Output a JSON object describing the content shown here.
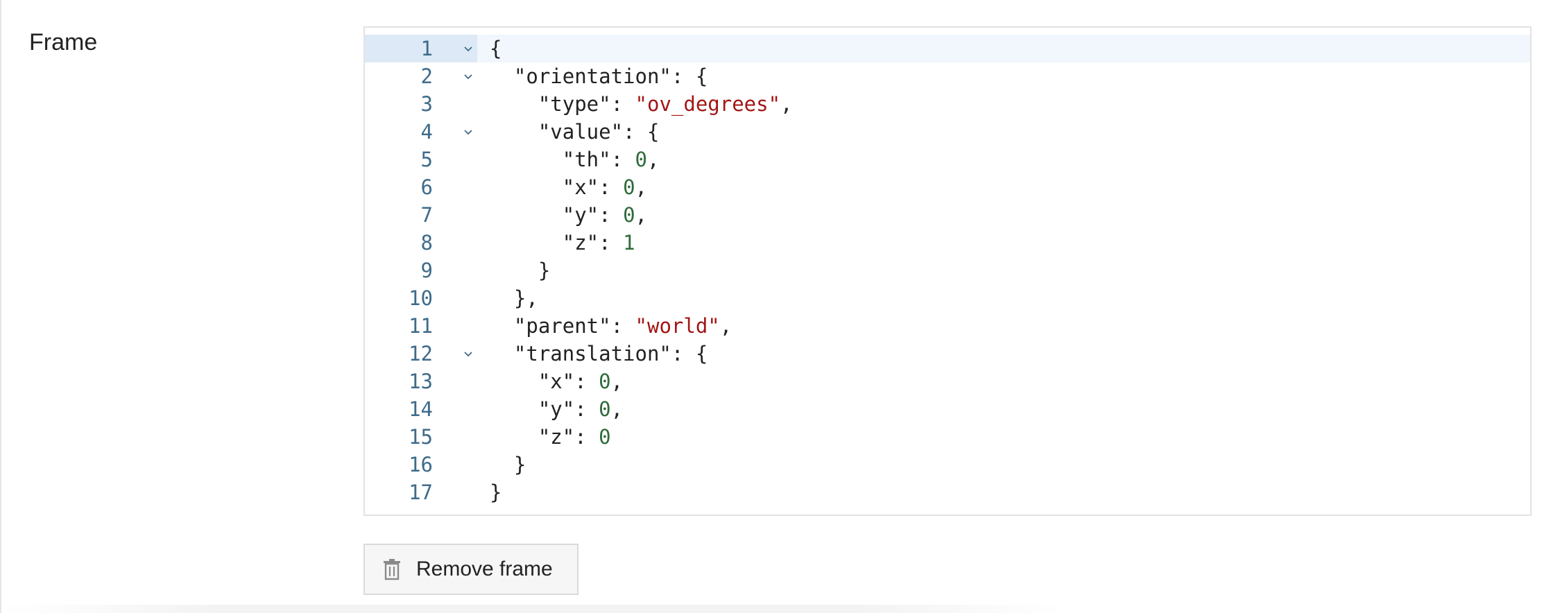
{
  "field": {
    "label": "Frame"
  },
  "editor": {
    "lines": [
      {
        "num": "1",
        "fold": true,
        "indent": "",
        "tokens": [
          {
            "t": "p",
            "v": "{"
          }
        ]
      },
      {
        "num": "2",
        "fold": true,
        "indent": "  ",
        "tokens": [
          {
            "t": "p",
            "v": "\"orientation\": {"
          }
        ]
      },
      {
        "num": "3",
        "fold": false,
        "indent": "    ",
        "tokens": [
          {
            "t": "p",
            "v": "\"type\": "
          },
          {
            "t": "s",
            "v": "\"ov_degrees\""
          },
          {
            "t": "p",
            "v": ","
          }
        ]
      },
      {
        "num": "4",
        "fold": true,
        "indent": "    ",
        "tokens": [
          {
            "t": "p",
            "v": "\"value\": {"
          }
        ]
      },
      {
        "num": "5",
        "fold": false,
        "indent": "      ",
        "tokens": [
          {
            "t": "p",
            "v": "\"th\": "
          },
          {
            "t": "n",
            "v": "0"
          },
          {
            "t": "p",
            "v": ","
          }
        ]
      },
      {
        "num": "6",
        "fold": false,
        "indent": "      ",
        "tokens": [
          {
            "t": "p",
            "v": "\"x\": "
          },
          {
            "t": "n",
            "v": "0"
          },
          {
            "t": "p",
            "v": ","
          }
        ]
      },
      {
        "num": "7",
        "fold": false,
        "indent": "      ",
        "tokens": [
          {
            "t": "p",
            "v": "\"y\": "
          },
          {
            "t": "n",
            "v": "0"
          },
          {
            "t": "p",
            "v": ","
          }
        ]
      },
      {
        "num": "8",
        "fold": false,
        "indent": "      ",
        "tokens": [
          {
            "t": "p",
            "v": "\"z\": "
          },
          {
            "t": "n",
            "v": "1"
          }
        ]
      },
      {
        "num": "9",
        "fold": false,
        "indent": "    ",
        "tokens": [
          {
            "t": "p",
            "v": "}"
          }
        ]
      },
      {
        "num": "10",
        "fold": false,
        "indent": "  ",
        "tokens": [
          {
            "t": "p",
            "v": "},"
          }
        ]
      },
      {
        "num": "11",
        "fold": false,
        "indent": "  ",
        "tokens": [
          {
            "t": "p",
            "v": "\"parent\": "
          },
          {
            "t": "s",
            "v": "\"world\""
          },
          {
            "t": "p",
            "v": ","
          }
        ]
      },
      {
        "num": "12",
        "fold": true,
        "indent": "  ",
        "tokens": [
          {
            "t": "p",
            "v": "\"translation\": {"
          }
        ]
      },
      {
        "num": "13",
        "fold": false,
        "indent": "    ",
        "tokens": [
          {
            "t": "p",
            "v": "\"x\": "
          },
          {
            "t": "n",
            "v": "0"
          },
          {
            "t": "p",
            "v": ","
          }
        ]
      },
      {
        "num": "14",
        "fold": false,
        "indent": "    ",
        "tokens": [
          {
            "t": "p",
            "v": "\"y\": "
          },
          {
            "t": "n",
            "v": "0"
          },
          {
            "t": "p",
            "v": ","
          }
        ]
      },
      {
        "num": "15",
        "fold": false,
        "indent": "    ",
        "tokens": [
          {
            "t": "p",
            "v": "\"z\": "
          },
          {
            "t": "n",
            "v": "0"
          }
        ]
      },
      {
        "num": "16",
        "fold": false,
        "indent": "  ",
        "tokens": [
          {
            "t": "p",
            "v": "}"
          }
        ]
      },
      {
        "num": "17",
        "fold": false,
        "indent": "",
        "tokens": [
          {
            "t": "p",
            "v": "}"
          }
        ]
      }
    ],
    "active_line": "1"
  },
  "actions": {
    "remove_label": "Remove frame",
    "remove_icon": "trash-icon"
  },
  "colors": {
    "string": "#a31515",
    "number": "#2e6b3a",
    "line_number": "#3e6b8a",
    "active_line_bg": "#f1f7fc"
  }
}
